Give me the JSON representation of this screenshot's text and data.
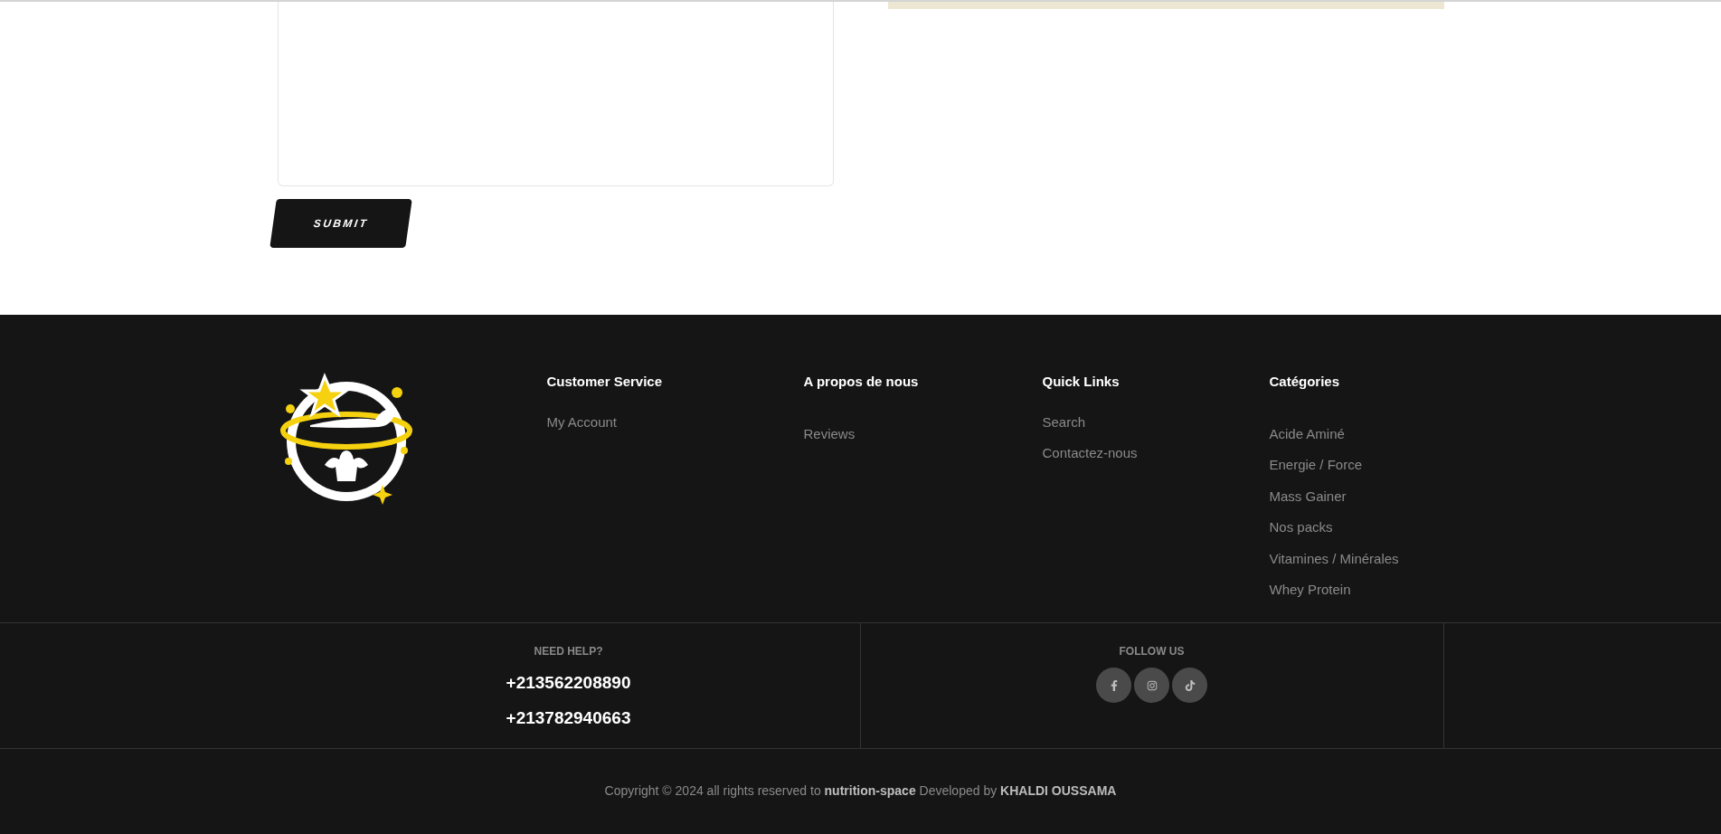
{
  "contact_form": {
    "submit_button": "SUBMIT"
  },
  "footer": {
    "columns": [
      {
        "heading": "Customer Service",
        "links": [
          "My Account"
        ]
      },
      {
        "heading": "A propos de nous",
        "links": [
          "Reviews"
        ]
      },
      {
        "heading": "Quick Links",
        "links": [
          "Search",
          "Contactez-nous"
        ]
      },
      {
        "heading": "Catégories",
        "links": [
          "Acide Aminé",
          "Energie / Force",
          "Mass Gainer",
          "Nos packs",
          "Vitamines / Minérales",
          "Whey Protein"
        ]
      }
    ],
    "help": {
      "label": "NEED HELP?",
      "phones": [
        "+213562208890",
        "+213782940663"
      ]
    },
    "follow": {
      "label": "FOLLOW US",
      "socials": [
        {
          "kind": "facebook"
        },
        {
          "kind": "instagram"
        },
        {
          "kind": "tiktok"
        }
      ]
    },
    "copyright": "Copyright © 2024 all rights reserved to **nutrition-space** Developed by **KHALDI OUSSAMA**"
  }
}
